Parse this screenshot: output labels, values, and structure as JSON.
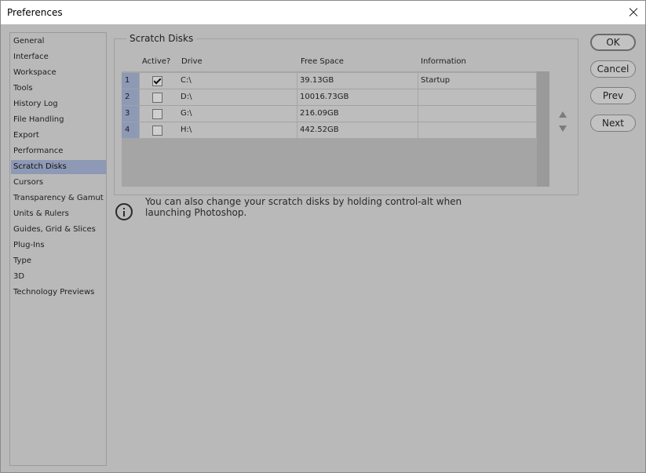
{
  "window": {
    "title": "Preferences"
  },
  "sidebar": {
    "items": [
      {
        "label": "General"
      },
      {
        "label": "Interface"
      },
      {
        "label": "Workspace"
      },
      {
        "label": "Tools"
      },
      {
        "label": "History Log"
      },
      {
        "label": "File Handling"
      },
      {
        "label": "Export"
      },
      {
        "label": "Performance"
      },
      {
        "label": "Scratch Disks",
        "selected": true
      },
      {
        "label": "Cursors"
      },
      {
        "label": "Transparency & Gamut"
      },
      {
        "label": "Units & Rulers"
      },
      {
        "label": "Guides, Grid & Slices"
      },
      {
        "label": "Plug-Ins"
      },
      {
        "label": "Type"
      },
      {
        "label": "3D"
      },
      {
        "label": "Technology Previews"
      }
    ]
  },
  "scratch": {
    "group_title": "Scratch Disks",
    "headers": {
      "active": "Active?",
      "drive": "Drive",
      "free": "Free Space",
      "info": "Information"
    },
    "rows": [
      {
        "num": "1",
        "active": true,
        "drive": "C:\\",
        "free": "39.13GB",
        "info": "Startup"
      },
      {
        "num": "2",
        "active": false,
        "drive": "D:\\",
        "free": "10016.73GB",
        "info": ""
      },
      {
        "num": "3",
        "active": false,
        "drive": "G:\\",
        "free": "216.09GB",
        "info": ""
      },
      {
        "num": "4",
        "active": false,
        "drive": "H:\\",
        "free": "442.52GB",
        "info": ""
      }
    ],
    "note": "You can also change your scratch disks by holding control-alt when launching Photoshop."
  },
  "buttons": {
    "ok": "OK",
    "cancel": "Cancel",
    "prev": "Prev",
    "next": "Next"
  }
}
